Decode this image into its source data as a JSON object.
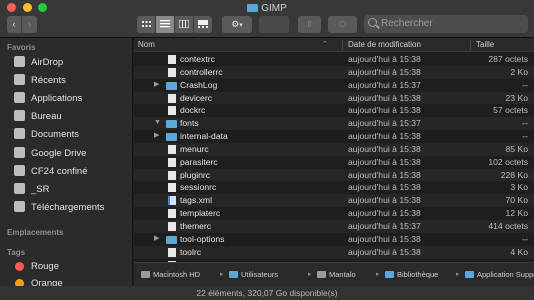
{
  "window": {
    "title": "GIMP"
  },
  "toolbar": {
    "back_label": "‹",
    "forward_label": "›",
    "gear_label": "⚙",
    "gear_caret": "▾",
    "share_label": "⇧",
    "tag_label": "⬭",
    "search_placeholder": "Rechercher"
  },
  "sidebar": {
    "favorites_header": "Favoris",
    "favorites": [
      {
        "label": "AirDrop",
        "icon": "airdrop-icon"
      },
      {
        "label": "Récents",
        "icon": "clock-icon"
      },
      {
        "label": "Applications",
        "icon": "applications-icon"
      },
      {
        "label": "Bureau",
        "icon": "desktop-icon"
      },
      {
        "label": "Documents",
        "icon": "document-icon"
      },
      {
        "label": "Google Drive",
        "icon": "google-drive-icon"
      },
      {
        "label": "CF24 confiné",
        "icon": "folder-icon"
      },
      {
        "label": "_SR",
        "icon": "folder-icon"
      },
      {
        "label": "Téléchargements",
        "icon": "download-icon"
      }
    ],
    "locations_header": "Emplacements",
    "tags_header": "Tags",
    "tags": [
      {
        "label": "Rouge",
        "color": "#ff5b55"
      },
      {
        "label": "Orange",
        "color": "#ff9f0a"
      }
    ]
  },
  "columns": {
    "name": "Nom",
    "date": "Date de modification",
    "size": "Taille",
    "sort_caret": "⌃"
  },
  "files": [
    {
      "name": "contextrc",
      "date": "aujourd'hui à 15:38",
      "size": "287 octets",
      "kind": "file",
      "disclosure": ""
    },
    {
      "name": "controllerrc",
      "date": "aujourd'hui à 15:38",
      "size": "2 Ko",
      "kind": "file",
      "disclosure": ""
    },
    {
      "name": "CrashLog",
      "date": "aujourd'hui à 15:37",
      "size": "--",
      "kind": "folder",
      "disclosure": "▶"
    },
    {
      "name": "devicerc",
      "date": "aujourd'hui à 15:38",
      "size": "23 Ko",
      "kind": "file",
      "disclosure": ""
    },
    {
      "name": "dockrc",
      "date": "aujourd'hui à 15:38",
      "size": "57 octets",
      "kind": "file",
      "disclosure": ""
    },
    {
      "name": "fonts",
      "date": "aujourd'hui à 15:37",
      "size": "--",
      "kind": "folder",
      "disclosure": "▼"
    },
    {
      "name": "internal-data",
      "date": "aujourd'hui à 15:38",
      "size": "--",
      "kind": "folder",
      "disclosure": "▶"
    },
    {
      "name": "menurc",
      "date": "aujourd'hui à 15:38",
      "size": "85 Ko",
      "kind": "file",
      "disclosure": ""
    },
    {
      "name": "parasiterc",
      "date": "aujourd'hui à 15:38",
      "size": "102 octets",
      "kind": "file",
      "disclosure": ""
    },
    {
      "name": "pluginrc",
      "date": "aujourd'hui à 15:38",
      "size": "228 Ko",
      "kind": "file",
      "disclosure": ""
    },
    {
      "name": "sessionrc",
      "date": "aujourd'hui à 15:38",
      "size": "3 Ko",
      "kind": "file",
      "disclosure": ""
    },
    {
      "name": "tags.xml",
      "date": "aujourd'hui à 15:38",
      "size": "70 Ko",
      "kind": "xml",
      "disclosure": ""
    },
    {
      "name": "templaterc",
      "date": "aujourd'hui à 15:38",
      "size": "12 Ko",
      "kind": "file",
      "disclosure": ""
    },
    {
      "name": "themerc",
      "date": "aujourd'hui à 15:37",
      "size": "414 octets",
      "kind": "file",
      "disclosure": ""
    },
    {
      "name": "tool-options",
      "date": "aujourd'hui à 15:38",
      "size": "--",
      "kind": "folder",
      "disclosure": "▶"
    },
    {
      "name": "toolrc",
      "date": "aujourd'hui à 15:38",
      "size": "4 Ko",
      "kind": "file",
      "disclosure": ""
    },
    {
      "name": "unitrc",
      "date": "aujourd'hui à 15:38",
      "size": "1 Ko",
      "kind": "file",
      "disclosure": ""
    }
  ],
  "pathbar": [
    {
      "label": "Macintosh HD",
      "icon": "hard-drive-icon"
    },
    {
      "label": "Utilisateurs",
      "icon": "folder-icon"
    },
    {
      "label": "Mantalo",
      "icon": "home-icon"
    },
    {
      "label": "Bibliothèque",
      "icon": "folder-icon"
    },
    {
      "label": "Application Support",
      "icon": "folder-icon"
    },
    {
      "label": "GIMP",
      "icon": "folder-icon"
    }
  ],
  "pathbar_separator": "▸",
  "status": {
    "text": "22 éléments, 320,07 Go disponible(s)"
  }
}
